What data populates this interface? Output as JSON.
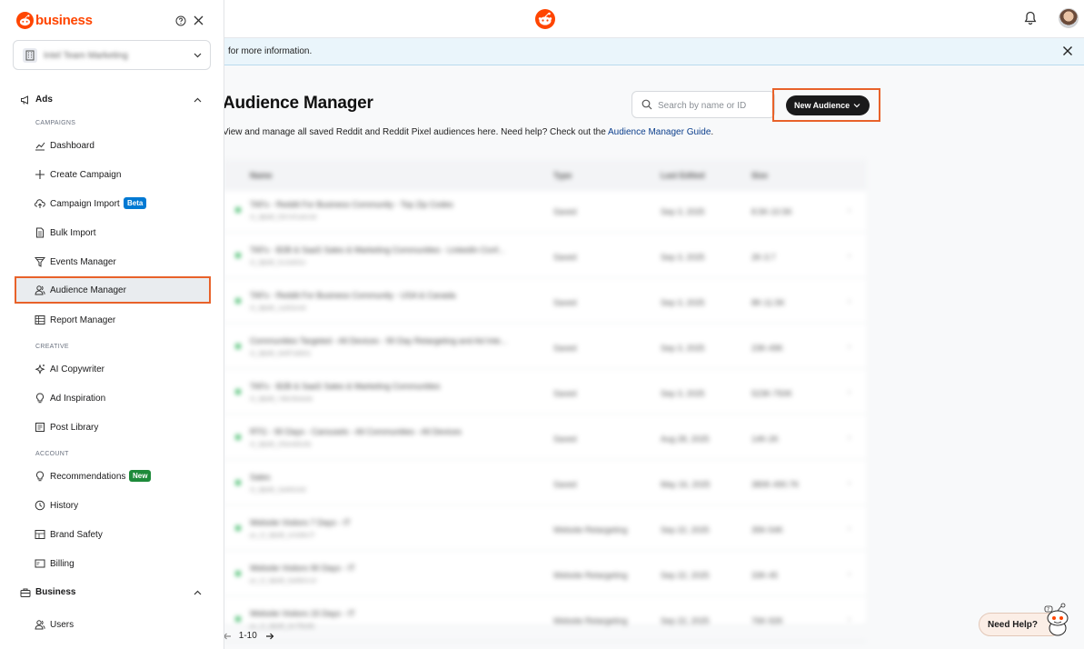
{
  "brand": {
    "name": "business",
    "accent": "#ff4500"
  },
  "sidebar": {
    "account_name": "Intel Team Marketing",
    "sections": {
      "ads": {
        "label": "Ads"
      },
      "business": {
        "label": "Business"
      }
    },
    "groups": {
      "campaigns": "CAMPAIGNS",
      "creative": "CREATIVE",
      "account": "ACCOUNT"
    },
    "items": {
      "dashboard": "Dashboard",
      "create_campaign": "Create Campaign",
      "campaign_import": "Campaign Import",
      "campaign_import_badge": "Beta",
      "bulk_import": "Bulk Import",
      "events_manager": "Events Manager",
      "audience_manager": "Audience Manager",
      "report_manager": "Report Manager",
      "ai_copywriter": "AI Copywriter",
      "ad_inspiration": "Ad Inspiration",
      "post_library": "Post Library",
      "recommendations": "Recommendations",
      "recommendations_badge": "New",
      "history": "History",
      "brand_safety": "Brand Safety",
      "billing": "Billing",
      "users": "Users"
    }
  },
  "banner": {
    "text": " for more information."
  },
  "main": {
    "title": "Audience Manager",
    "subtitle_prefix": "View and manage all saved Reddit and Reddit Pixel audiences here. Need help? Check out the ",
    "subtitle_link": "Audience Manager Guide",
    "subtitle_suffix": ".",
    "search_placeholder": "Search by name or ID",
    "new_audience_label": "New Audience",
    "table": {
      "headers": [
        "Name",
        "Type",
        "Last Edited",
        "Size"
      ],
      "rows": [
        {
          "name": "TAFs - Reddit For Business Community - Top Zip Codes",
          "sub": "t2_8jbd8_f2b7ef1a5c3d",
          "type": "Saved",
          "date": "Sep 3, 2025",
          "size": "8.5K-10.5K"
        },
        {
          "name": "TAFs - B2B & SaaS Sales & Marketing Communities - LinkedIn Conf...",
          "sub": "t2_8jbd8_5c2a9d1e",
          "type": "Saved",
          "date": "Sep 3, 2025",
          "size": "2K-3.7"
        },
        {
          "name": "TAFs - Reddit For Business Community - USA & Canada",
          "sub": "t2_8jbd8_1a2b3c4d",
          "type": "Saved",
          "date": "Sep 3, 2025",
          "size": "8K-11.5K"
        },
        {
          "name": "Communities Targeted - All Devices - 90 Day Retargeting and Ad Inte...",
          "sub": "t2_8jbd8_9e8f7a6b5c",
          "type": "Saved",
          "date": "Sep 3, 2025",
          "size": "23K-49K"
        },
        {
          "name": "TAFs - B2B & SaaS Sales & Marketing Communities",
          "sub": "t2_8jbd8_7d6c5b4a3e",
          "type": "Saved",
          "date": "Sep 3, 2025",
          "size": "523K-750K"
        },
        {
          "name": "RTG - 90 Days - Carousels - All Communities - All Devices",
          "sub": "t2_8jbd8_2f3e4d5c6b",
          "type": "Saved",
          "date": "Aug 28, 2025",
          "size": "14K-2K"
        },
        {
          "name": "Sales",
          "sub": "t2_8jbd8_3a4b5c6d",
          "type": "Saved",
          "date": "May 16, 2025",
          "size": "380K-490.7K"
        },
        {
          "name": "Website Visitors 7 Days - IT",
          "sub": "pv_t2_8jbd8_4c5d6e7f",
          "type": "Website Retargeting",
          "date": "Sep 22, 2025",
          "size": "35K-54K"
        },
        {
          "name": "Website Visitors 90 Days - IT",
          "sub": "pv_t2_8jbd8_8a9b0c1d",
          "type": "Website Retargeting",
          "date": "Sep 22, 2025",
          "size": "33K-45"
        },
        {
          "name": "Website Visitors 15 Days - IT",
          "sub": "pv_t2_8jbd8_6e7f8a9b",
          "type": "Website Retargeting",
          "date": "Sep 22, 2025",
          "size": "76K-92K"
        }
      ]
    },
    "pager": {
      "range": "1-10"
    },
    "need_help": "Need Help?"
  },
  "colors": {
    "highlight": "#e8622a",
    "success": "#2eb35b",
    "link": "#0b3e8c",
    "button_dark": "#1a1a1b"
  },
  "icons": [
    "reddit-logo-icon",
    "help-circle-icon",
    "close-icon",
    "building-icon",
    "chevron-down-icon",
    "chevron-up-icon",
    "megaphone-icon",
    "chart-line-icon",
    "plus-icon",
    "cloud-upload-icon",
    "file-icon",
    "funnel-icon",
    "users-icon",
    "table-icon",
    "sparkle-icon",
    "lightbulb-icon",
    "post-icon",
    "history-icon",
    "grid-icon",
    "billing-icon",
    "briefcase-icon",
    "bell-icon",
    "search-icon",
    "arrow-left-icon",
    "arrow-right-icon"
  ]
}
